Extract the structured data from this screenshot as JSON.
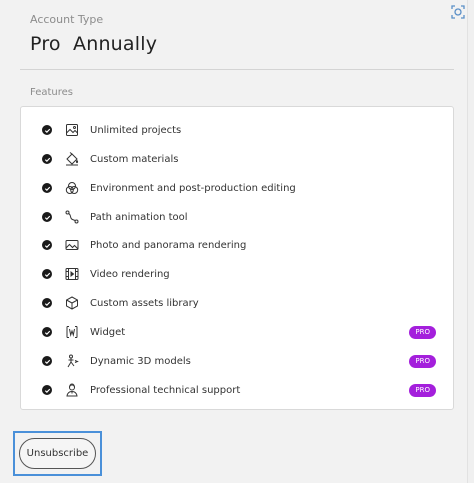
{
  "account": {
    "label": "Account Type",
    "plan": "Pro",
    "billing": "Annually"
  },
  "features": {
    "label": "Features",
    "items": [
      {
        "label": "Unlimited projects",
        "icon": "image-frame-icon",
        "pro": false
      },
      {
        "label": "Custom materials",
        "icon": "paint-bucket-icon",
        "pro": false
      },
      {
        "label": "Environment and post-production editing",
        "icon": "color-circles-icon",
        "pro": false
      },
      {
        "label": "Path animation tool",
        "icon": "path-icon",
        "pro": false
      },
      {
        "label": "Photo and panorama rendering",
        "icon": "photo-icon",
        "pro": false
      },
      {
        "label": "Video rendering",
        "icon": "film-icon",
        "pro": false
      },
      {
        "label": "Custom assets library",
        "icon": "cube-icon",
        "pro": false
      },
      {
        "label": "Widget",
        "icon": "widget-icon",
        "pro": true
      },
      {
        "label": "Dynamic 3D models",
        "icon": "dynamic-model-icon",
        "pro": true
      },
      {
        "label": "Professional technical support",
        "icon": "support-icon",
        "pro": true
      }
    ],
    "pro_badge": "PRO"
  },
  "unsubscribe_label": "Unsubscribe",
  "colors": {
    "badge": "#a41fdc",
    "highlight_frame": "#4a90d9"
  }
}
